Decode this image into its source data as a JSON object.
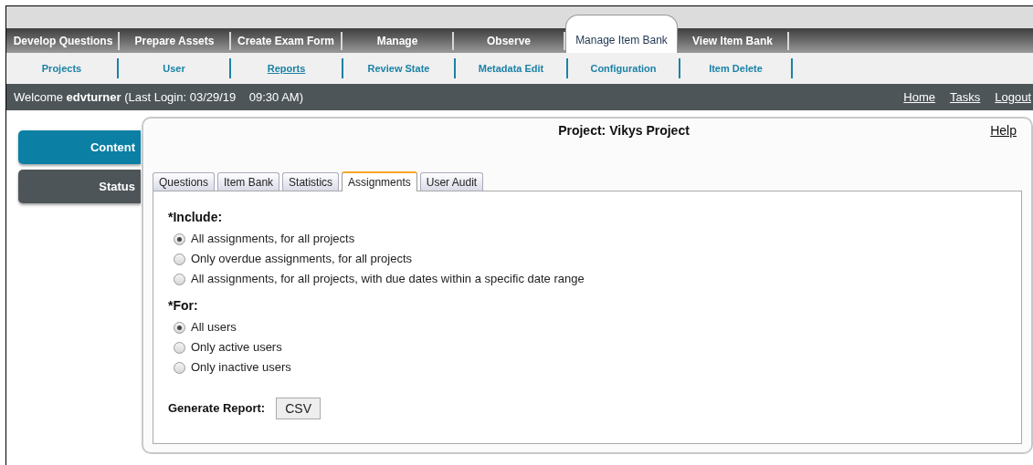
{
  "main_nav": [
    {
      "label": "Develop Questions",
      "selected": false
    },
    {
      "label": "Prepare Assets",
      "selected": false
    },
    {
      "label": "Create Exam Form",
      "selected": false
    },
    {
      "label": "Manage",
      "selected": false
    },
    {
      "label": "Observe",
      "selected": false
    },
    {
      "label": "Manage Item Bank",
      "selected": true
    },
    {
      "label": "View Item Bank",
      "selected": false
    }
  ],
  "sub_nav": [
    {
      "label": "Projects",
      "selected": false
    },
    {
      "label": "User",
      "selected": false
    },
    {
      "label": "Reports",
      "selected": true
    },
    {
      "label": "Review State",
      "selected": false
    },
    {
      "label": "Metadata Edit",
      "selected": false
    },
    {
      "label": "Configuration",
      "selected": false
    },
    {
      "label": "Item Delete",
      "selected": false
    }
  ],
  "welcome": {
    "prefix": "Welcome",
    "user": "edvturner",
    "login": "(Last Login: 03/29/19    09:30 AM)"
  },
  "header_links": [
    "Home",
    "Tasks",
    "Logout"
  ],
  "sidebar": [
    {
      "label": "Content",
      "selected": true
    },
    {
      "label": "Status",
      "selected": false
    }
  ],
  "panel": {
    "title": "Project: Vikys Project",
    "help": "Help",
    "tabs": [
      {
        "label": "Questions",
        "selected": false
      },
      {
        "label": "Item Bank",
        "selected": false
      },
      {
        "label": "Statistics",
        "selected": false
      },
      {
        "label": "Assignments",
        "selected": true
      },
      {
        "label": "User Audit",
        "selected": false
      }
    ],
    "groups": [
      {
        "label": "*Include:",
        "options": [
          {
            "label": "All assignments, for all projects",
            "selected": true
          },
          {
            "label": "Only overdue assignments, for all projects",
            "selected": false
          },
          {
            "label": "All assignments, for all projects, with due dates within a specific date range",
            "selected": false
          }
        ]
      },
      {
        "label": "*For:",
        "options": [
          {
            "label": "All users",
            "selected": true
          },
          {
            "label": "Only active users",
            "selected": false
          },
          {
            "label": "Only inactive users",
            "selected": false
          }
        ]
      }
    ],
    "generate_label": "Generate Report:",
    "generate_button": "CSV"
  }
}
